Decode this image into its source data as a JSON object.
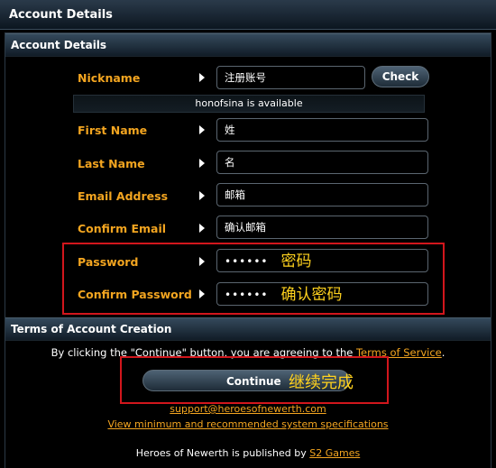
{
  "window": {
    "title": "Account Details"
  },
  "account_section": {
    "title": "Account Details"
  },
  "fields": {
    "nickname": {
      "label": "Nickname",
      "value": "注册账号"
    },
    "check_button": "Check",
    "availability": "honofsina is available",
    "first_name": {
      "label": "First Name",
      "value": "姓"
    },
    "last_name": {
      "label": "Last Name",
      "value": "名"
    },
    "email": {
      "label": "Email Address",
      "value": "邮箱"
    },
    "confirm_email": {
      "label": "Confirm Email",
      "value": "确认邮箱"
    },
    "password": {
      "label": "Password",
      "masked": "••••••",
      "annotation": "密码"
    },
    "confirm_password": {
      "label": "Confirm Password",
      "masked": "••••••",
      "annotation": "确认密码"
    }
  },
  "terms_section": {
    "title": "Terms of Account Creation",
    "text_before": "By clicking the \"Continue\" button, you are agreeing to the ",
    "link": "Terms of Service",
    "text_after": "."
  },
  "continue": {
    "label": "Continue",
    "annotation": "继续完成"
  },
  "links": {
    "support": "support@heroesofnewerth.com",
    "specs": "View minimum and recommended system specifications"
  },
  "footer": {
    "text": "Heroes of Newerth is published by ",
    "link": "S2 Games"
  },
  "colors": {
    "label": "#f3a520",
    "highlight_box": "#d2161c",
    "annotation": "#ffd21e"
  }
}
